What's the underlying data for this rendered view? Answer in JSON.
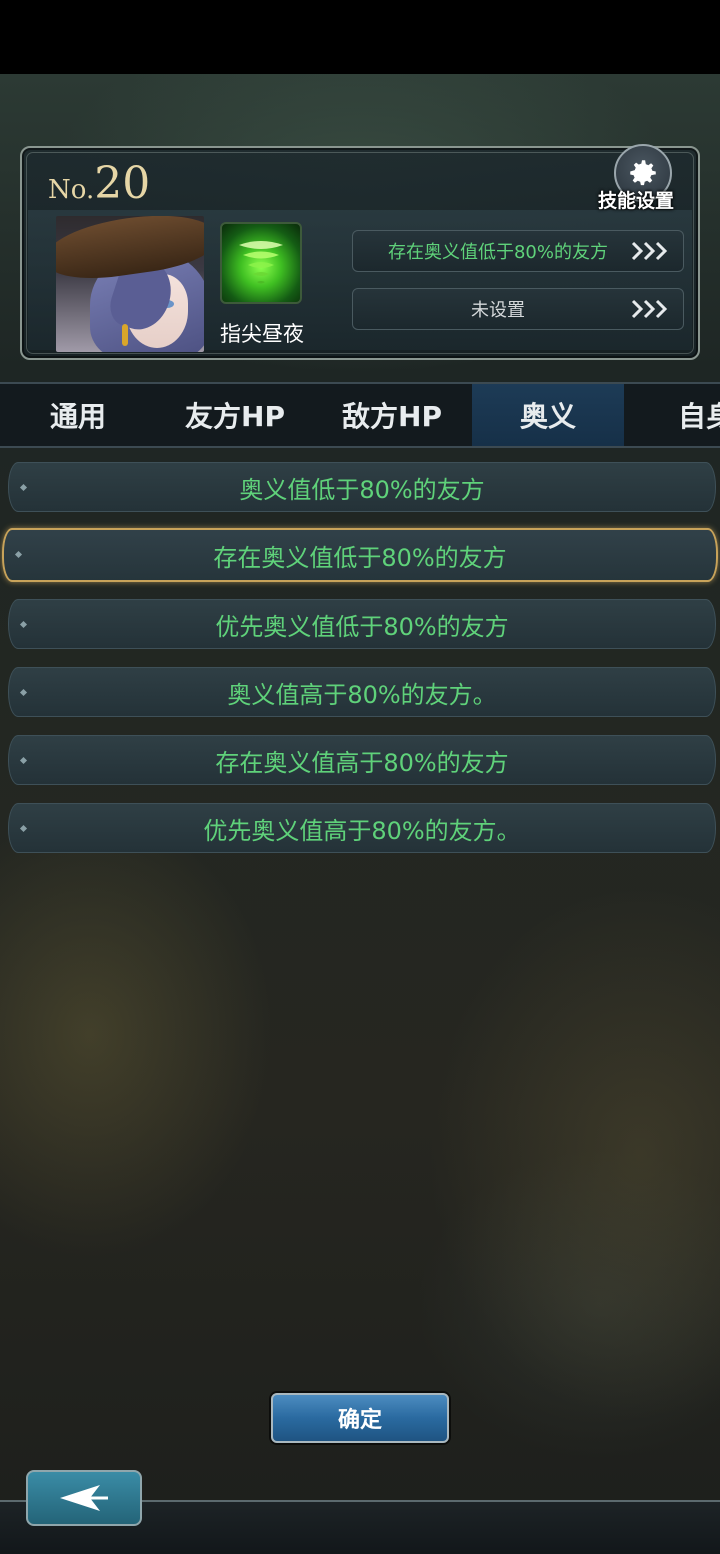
{
  "card": {
    "no_prefix": "No.",
    "no_value": "20",
    "skill_name": "指尖昼夜",
    "settings_label": "技能设置",
    "slots": [
      {
        "label": "存在奥义值低于80%的友方",
        "icon": "triple-chevron-right-icon"
      },
      {
        "label": "未设置",
        "icon": "triple-chevron-right-icon"
      }
    ]
  },
  "tabs": [
    {
      "label": "通用",
      "active": false
    },
    {
      "label": "友方HP",
      "active": false
    },
    {
      "label": "敌方HP",
      "active": false
    },
    {
      "label": "奥义",
      "active": true
    },
    {
      "label": "自身",
      "active": false
    }
  ],
  "options": [
    {
      "label": "奥义值低于80%的友方",
      "selected": false
    },
    {
      "label": "存在奥义值低于80%的友方",
      "selected": true
    },
    {
      "label": "优先奥义值低于80%的友方",
      "selected": false
    },
    {
      "label": "奥义值高于80%的友方。",
      "selected": false
    },
    {
      "label": "存在奥义值高于80%的友方",
      "selected": false
    },
    {
      "label": "优先奥义值高于80%的友方。",
      "selected": false
    }
  ],
  "confirm_label": "确定",
  "icons": {
    "settings": "gear-icon",
    "back": "back-arrow-icon",
    "skill": "green-tornado-icon"
  },
  "colors": {
    "option_text": "#5fd27a",
    "selected_border": "#c8a35a",
    "active_tab": "#1d3b56",
    "confirm_button": "#2a6aa0"
  }
}
